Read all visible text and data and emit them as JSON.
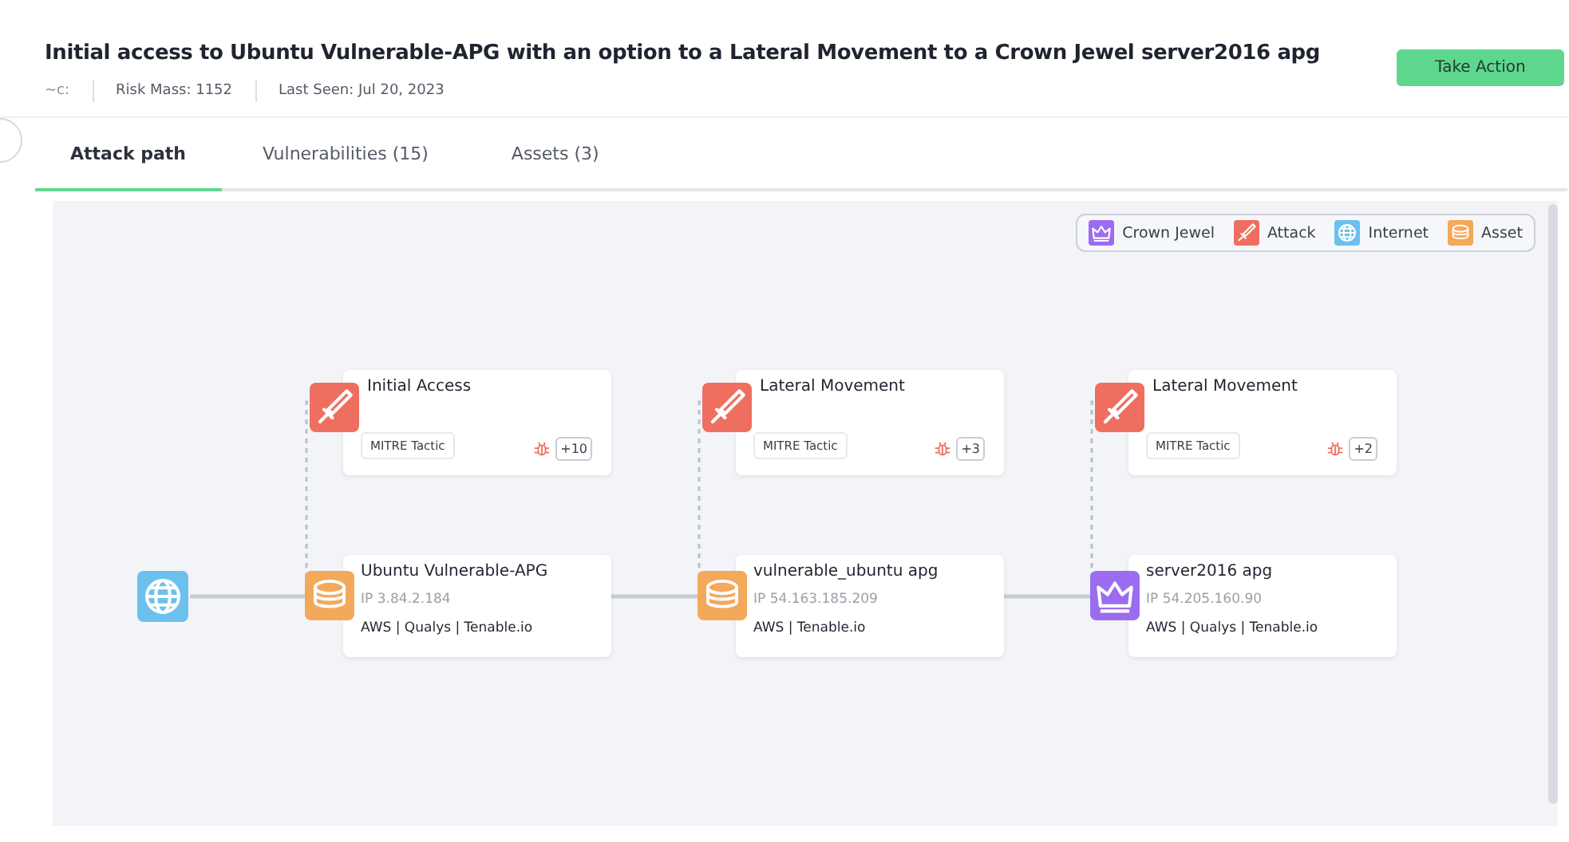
{
  "header": {
    "title": "Initial access to Ubuntu Vulnerable-APG with an option to a Lateral Movement to a Crown Jewel server2016 apg",
    "meta": [
      "~c:",
      "Risk Mass: 1152",
      "Last Seen: Jul 20, 2023"
    ],
    "action_button": "Take Action"
  },
  "tabs": [
    {
      "label": "Attack path",
      "selected": true
    },
    {
      "label": "Vulnerabilities (15)",
      "selected": false
    },
    {
      "label": "Assets (3)",
      "selected": false
    }
  ],
  "legend": [
    {
      "kind": "crown_jewel",
      "label": "Crown Jewel"
    },
    {
      "kind": "attack",
      "label": "Attack"
    },
    {
      "kind": "internet",
      "label": "Internet"
    },
    {
      "kind": "asset",
      "label": "Asset"
    }
  ],
  "path": {
    "origin": {
      "kind": "internet"
    },
    "steps": [
      {
        "tactic": {
          "title": "Initial Access",
          "tag": "MITRE Tactic",
          "count": "+10"
        },
        "asset": {
          "kind": "asset",
          "name": "Ubuntu Vulnerable-APG",
          "ip": "IP 3.84.2.184",
          "sources": "AWS | Qualys | Tenable.io"
        }
      },
      {
        "tactic": {
          "title": "Lateral Movement",
          "tag": "MITRE Tactic",
          "count": "+3"
        },
        "asset": {
          "kind": "asset",
          "name": "vulnerable_ubuntu apg",
          "ip": "IP 54.163.185.209",
          "sources": "AWS | Tenable.io"
        }
      },
      {
        "tactic": {
          "title": "Lateral Movement",
          "tag": "MITRE Tactic",
          "count": "+2"
        },
        "asset": {
          "kind": "crown_jewel",
          "name": "server2016 apg",
          "ip": "IP 54.205.160.90",
          "sources": "AWS | Qualys | Tenable.io"
        }
      }
    ]
  }
}
